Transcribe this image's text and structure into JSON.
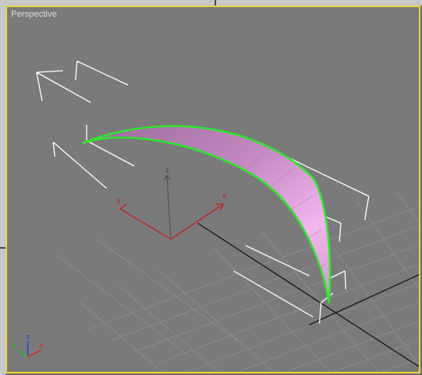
{
  "viewport": {
    "label": "Perspective",
    "border_color": "#e8d43a",
    "background": "#7a7a7a"
  },
  "gizmo": {
    "x_label": "x",
    "y_label": "y",
    "z_label": "z"
  },
  "view_axis": {
    "x_label": "x",
    "y_label": "y",
    "z_label": "z"
  },
  "colors": {
    "grid": "#8c8c8c",
    "grid_major": "#111111",
    "selection_outline": "#2ee62e",
    "surface_light": "#f0b0ec",
    "surface_dark": "#b07ab0",
    "bracket": "#ffffff",
    "gizmo_red": "#c02020",
    "gizmo_dark": "#555555",
    "axis_x": "#e02020",
    "axis_y": "#20c020",
    "axis_z": "#2040e0"
  },
  "icons": {
    "selection_brackets": "selection-bracket-icon",
    "transform_gizmo": "transform-gizmo-icon",
    "view_axis": "view-axis-tripod-icon"
  }
}
